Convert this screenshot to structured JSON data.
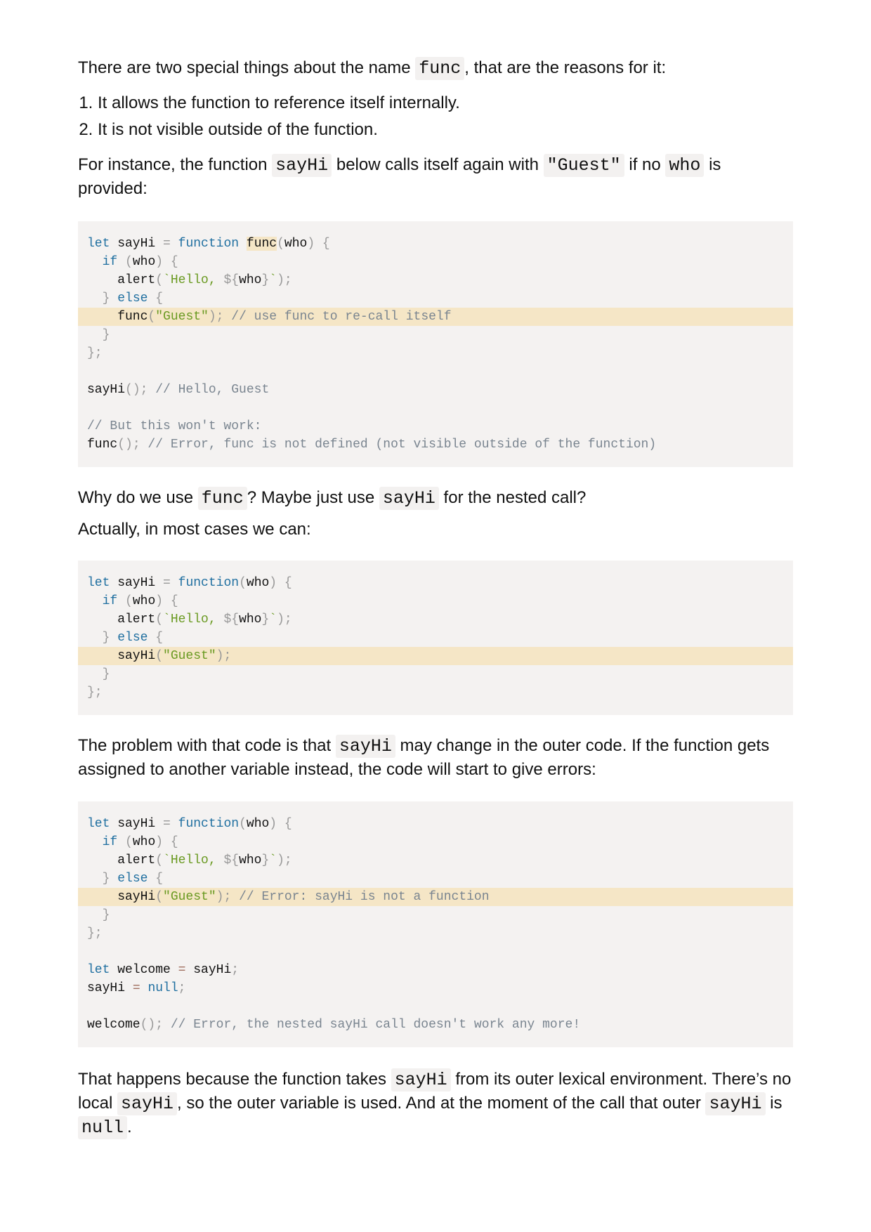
{
  "intro": {
    "before": "There are two special things about the name ",
    "code": "func",
    "after": ", that are the reasons for it:"
  },
  "reasons": [
    "It allows the function to reference itself internally.",
    "It is not visible outside of the function."
  ],
  "instance": {
    "t1": "For instance, the function ",
    "c1": "sayHi",
    "t2": " below calls itself again with ",
    "c2": "\"Guest\"",
    "t3": " if no ",
    "c3": "who",
    "t4": " is provided:"
  },
  "why": {
    "t1": "Why do we use ",
    "c1": "func",
    "t2": "? Maybe just use ",
    "c2": "sayHi",
    "t3": " for the nested call?"
  },
  "actually": "Actually, in most cases we can:",
  "problem": {
    "t1": "The problem with that code is that ",
    "c1": "sayHi",
    "t2": " may change in the outer code. If the function gets assigned to another variable instead, the code will start to give errors:"
  },
  "happens": {
    "t1": "That happens because the function takes ",
    "c1": "sayHi",
    "t2": " from its outer lexical environment. There’s no local ",
    "c2": "sayHi",
    "t3": ", so the outer variable is used. And at the moment of the call that outer ",
    "c3": "sayHi",
    "t4": " is ",
    "c4": "null",
    "t5": "."
  },
  "code_blocks": [
    {
      "lines": [
        [
          [
            "kw",
            "let"
          ],
          [
            "id",
            " sayHi "
          ],
          [
            "pn",
            "="
          ],
          [
            "id",
            " "
          ],
          [
            "kw",
            "function"
          ],
          [
            "id",
            " "
          ],
          [
            "mark",
            "func"
          ],
          [
            "pn",
            "("
          ],
          [
            "id",
            "who"
          ],
          [
            "pn",
            ") {"
          ]
        ],
        [
          [
            "id",
            "  "
          ],
          [
            "kw",
            "if"
          ],
          [
            "id",
            " "
          ],
          [
            "pn",
            "("
          ],
          [
            "id",
            "who"
          ],
          [
            "pn",
            ") {"
          ]
        ],
        [
          [
            "id",
            "    alert"
          ],
          [
            "pn",
            "("
          ],
          [
            "st",
            "`Hello, "
          ],
          [
            "pn",
            "${"
          ],
          [
            "id",
            "who"
          ],
          [
            "pn",
            "}"
          ],
          [
            "st",
            "`"
          ],
          [
            "pn",
            ");"
          ]
        ],
        [
          [
            "pn",
            "  } "
          ],
          [
            "kw",
            "else"
          ],
          [
            "pn",
            " {"
          ]
        ],
        [
          [
            "id",
            "    func"
          ],
          [
            "pn",
            "("
          ],
          [
            "st",
            "\"Guest\""
          ],
          [
            "pn",
            ");"
          ],
          [
            "cm",
            " // use func to re-call itself"
          ]
        ],
        [
          [
            "pn",
            "  }"
          ]
        ],
        [
          [
            "pn",
            "};"
          ]
        ],
        [],
        [
          [
            "id",
            "sayHi"
          ],
          [
            "pn",
            "();"
          ],
          [
            "cm",
            " // Hello, Guest"
          ]
        ],
        [],
        [
          [
            "cm",
            "// But this won't work:"
          ]
        ],
        [
          [
            "id",
            "func"
          ],
          [
            "pn",
            "();"
          ],
          [
            "cm",
            " // Error, func is not defined (not visible outside of the function)"
          ]
        ]
      ],
      "highlight": [
        4
      ]
    },
    {
      "lines": [
        [
          [
            "kw",
            "let"
          ],
          [
            "id",
            " sayHi "
          ],
          [
            "pn",
            "="
          ],
          [
            "id",
            " "
          ],
          [
            "kw",
            "function"
          ],
          [
            "pn",
            "("
          ],
          [
            "id",
            "who"
          ],
          [
            "pn",
            ") {"
          ]
        ],
        [
          [
            "id",
            "  "
          ],
          [
            "kw",
            "if"
          ],
          [
            "id",
            " "
          ],
          [
            "pn",
            "("
          ],
          [
            "id",
            "who"
          ],
          [
            "pn",
            ") {"
          ]
        ],
        [
          [
            "id",
            "    alert"
          ],
          [
            "pn",
            "("
          ],
          [
            "st",
            "`Hello, "
          ],
          [
            "pn",
            "${"
          ],
          [
            "id",
            "who"
          ],
          [
            "pn",
            "}"
          ],
          [
            "st",
            "`"
          ],
          [
            "pn",
            ");"
          ]
        ],
        [
          [
            "pn",
            "  } "
          ],
          [
            "kw",
            "else"
          ],
          [
            "pn",
            " {"
          ]
        ],
        [
          [
            "id",
            "    sayHi"
          ],
          [
            "pn",
            "("
          ],
          [
            "st",
            "\"Guest\""
          ],
          [
            "pn",
            ");"
          ]
        ],
        [
          [
            "pn",
            "  }"
          ]
        ],
        [
          [
            "pn",
            "};"
          ]
        ]
      ],
      "highlight": [
        4
      ]
    },
    {
      "lines": [
        [
          [
            "kw",
            "let"
          ],
          [
            "id",
            " sayHi "
          ],
          [
            "pn",
            "="
          ],
          [
            "id",
            " "
          ],
          [
            "kw",
            "function"
          ],
          [
            "pn",
            "("
          ],
          [
            "id",
            "who"
          ],
          [
            "pn",
            ") {"
          ]
        ],
        [
          [
            "id",
            "  "
          ],
          [
            "kw",
            "if"
          ],
          [
            "id",
            " "
          ],
          [
            "pn",
            "("
          ],
          [
            "id",
            "who"
          ],
          [
            "pn",
            ") {"
          ]
        ],
        [
          [
            "id",
            "    alert"
          ],
          [
            "pn",
            "("
          ],
          [
            "st",
            "`Hello, "
          ],
          [
            "pn",
            "${"
          ],
          [
            "id",
            "who"
          ],
          [
            "pn",
            "}"
          ],
          [
            "st",
            "`"
          ],
          [
            "pn",
            ");"
          ]
        ],
        [
          [
            "pn",
            "  } "
          ],
          [
            "kw",
            "else"
          ],
          [
            "pn",
            " {"
          ]
        ],
        [
          [
            "id",
            "    sayHi"
          ],
          [
            "pn",
            "("
          ],
          [
            "st",
            "\"Guest\""
          ],
          [
            "pn",
            ");"
          ],
          [
            "cm",
            " // Error: sayHi is not a function"
          ]
        ],
        [
          [
            "pn",
            "  }"
          ]
        ],
        [
          [
            "pn",
            "};"
          ]
        ],
        [],
        [
          [
            "kw",
            "let"
          ],
          [
            "id",
            " welcome "
          ],
          [
            "op",
            "="
          ],
          [
            "id",
            " sayHi"
          ],
          [
            "pn",
            ";"
          ]
        ],
        [
          [
            "id",
            "sayHi "
          ],
          [
            "op",
            "="
          ],
          [
            "id",
            " "
          ],
          [
            "kw",
            "null"
          ],
          [
            "pn",
            ";"
          ]
        ],
        [],
        [
          [
            "id",
            "welcome"
          ],
          [
            "pn",
            "();"
          ],
          [
            "cm",
            " // Error, the nested sayHi call doesn't work any more!"
          ]
        ]
      ],
      "highlight": [
        4
      ]
    }
  ]
}
